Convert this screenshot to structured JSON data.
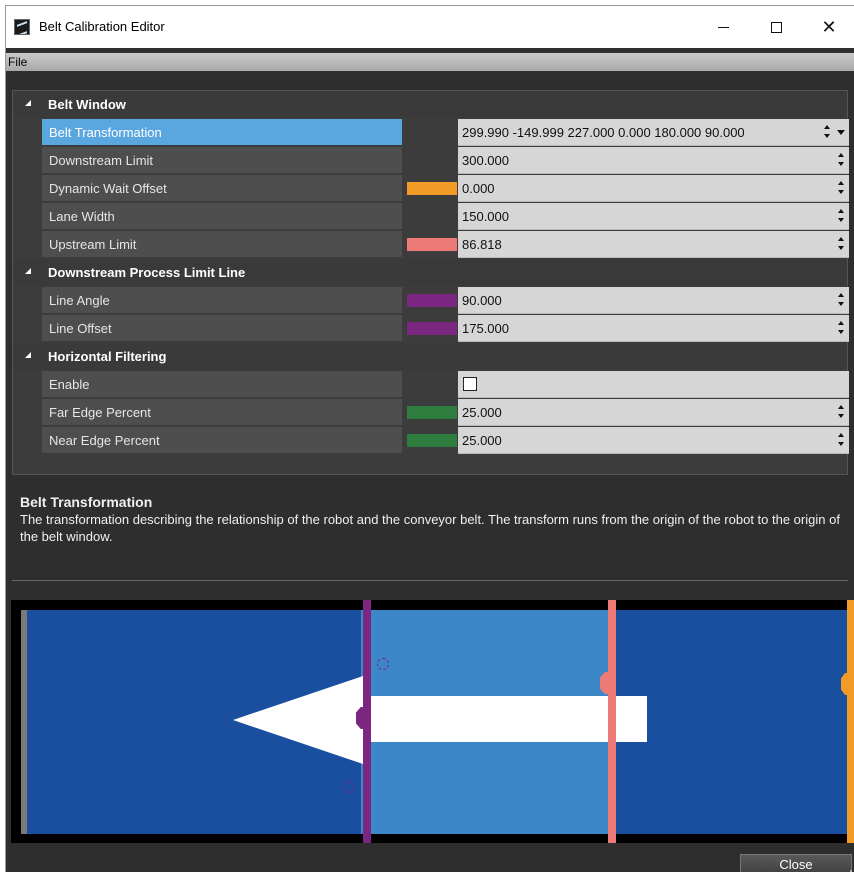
{
  "window": {
    "title": "Belt Calibration Editor",
    "controls": {
      "minimize": "minimize",
      "maximize": "maximize",
      "close": "✕"
    }
  },
  "menu": {
    "file": "File"
  },
  "propgrid": {
    "categories": [
      {
        "label": "Belt Window",
        "props": [
          {
            "label": "Belt Transformation",
            "value": "299.990 -149.999 227.000 0.000 180.000 90.000",
            "swatch": "",
            "selected": true
          },
          {
            "label": "Downstream Limit",
            "value": "300.000",
            "swatch": ""
          },
          {
            "label": "Dynamic Wait Offset",
            "value": "0.000",
            "swatch": "#f29c28"
          },
          {
            "label": "Lane Width",
            "value": "150.000",
            "swatch": ""
          },
          {
            "label": "Upstream Limit",
            "value": "86.818",
            "swatch": "#ee7a78"
          }
        ]
      },
      {
        "label": "Downstream Process Limit Line",
        "props": [
          {
            "label": "Line Angle",
            "value": "90.000",
            "swatch": "#7b2680"
          },
          {
            "label": "Line Offset",
            "value": "175.000",
            "swatch": "#7b2680"
          }
        ]
      },
      {
        "label": "Horizontal Filtering",
        "props": [
          {
            "label": "Enable",
            "value": "",
            "checkbox": false,
            "swatch": ""
          },
          {
            "label": "Far Edge Percent",
            "value": "25.000",
            "swatch": "#2e7d3e"
          },
          {
            "label": "Near Edge Percent",
            "value": "25.000",
            "swatch": "#2e7d3e"
          }
        ]
      }
    ]
  },
  "description": {
    "title": "Belt Transformation",
    "text": "The transformation describing the relationship of the robot and the conveyor belt. The transform runs from the origin of the robot to the origin of the belt window."
  },
  "colors": {
    "belt": "#1a4fa0",
    "lane": "#3b87c8",
    "downstream_process_line": "#7b2680",
    "upstream_limit_line": "#ee7a78",
    "dynamic_wait_line": "#f29c28"
  },
  "footer": {
    "close_label": "Close"
  }
}
